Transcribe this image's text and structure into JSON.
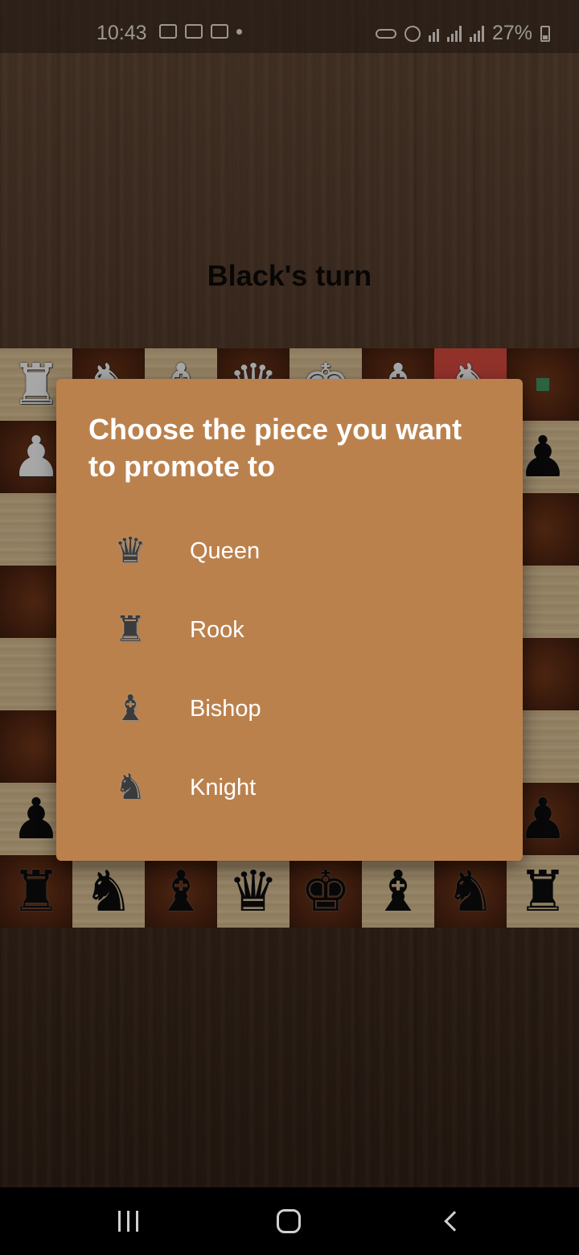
{
  "status_bar": {
    "time": "10:43",
    "battery": "27%",
    "left_icons": [
      "image-icon",
      "calendar-icon",
      "video-icon",
      "dot-icon"
    ],
    "right_icons": [
      "key-icon",
      "alarm-icon",
      "wifi-icon",
      "signal-icon",
      "signal-icon",
      "battery-icon"
    ]
  },
  "game": {
    "turn_text": "Black's turn"
  },
  "board": {
    "rows": [
      [
        "wR",
        "wN",
        "wB",
        "wQ",
        "wK",
        "wB",
        "wN",
        ""
      ],
      [
        "wP",
        "",
        "",
        "",
        "",
        "",
        "",
        "bP"
      ],
      [
        "",
        "",
        "",
        "",
        "",
        "",
        "",
        ""
      ],
      [
        "",
        "",
        "",
        "",
        "",
        "",
        "",
        ""
      ],
      [
        "",
        "",
        "",
        "",
        "",
        "",
        "",
        ""
      ],
      [
        "",
        "",
        "",
        "",
        "",
        "",
        "",
        ""
      ],
      [
        "bP",
        "",
        "",
        "",
        "",
        "",
        "",
        "bP"
      ],
      [
        "bR",
        "bN",
        "bB",
        "bQ",
        "bK",
        "bB",
        "bN",
        "bR"
      ]
    ],
    "highlighted_square": "g8",
    "colors": {
      "light_square": "#cdb48c",
      "dark_square": "#4a2210",
      "highlight": "#c9463b",
      "marker": "#3d8a5a"
    }
  },
  "dialog": {
    "title": "Choose the piece you want to promote to",
    "background": "#bb814d",
    "options": [
      {
        "label": "Queen",
        "icon": "queen-icon",
        "glyph": "♛"
      },
      {
        "label": "Rook",
        "icon": "rook-icon",
        "glyph": "♜"
      },
      {
        "label": "Bishop",
        "icon": "bishop-icon",
        "glyph": "♝"
      },
      {
        "label": "Knight",
        "icon": "knight-icon",
        "glyph": "♞"
      }
    ]
  },
  "nav_bar": {
    "buttons": [
      "recents-icon",
      "home-icon",
      "back-icon"
    ]
  }
}
